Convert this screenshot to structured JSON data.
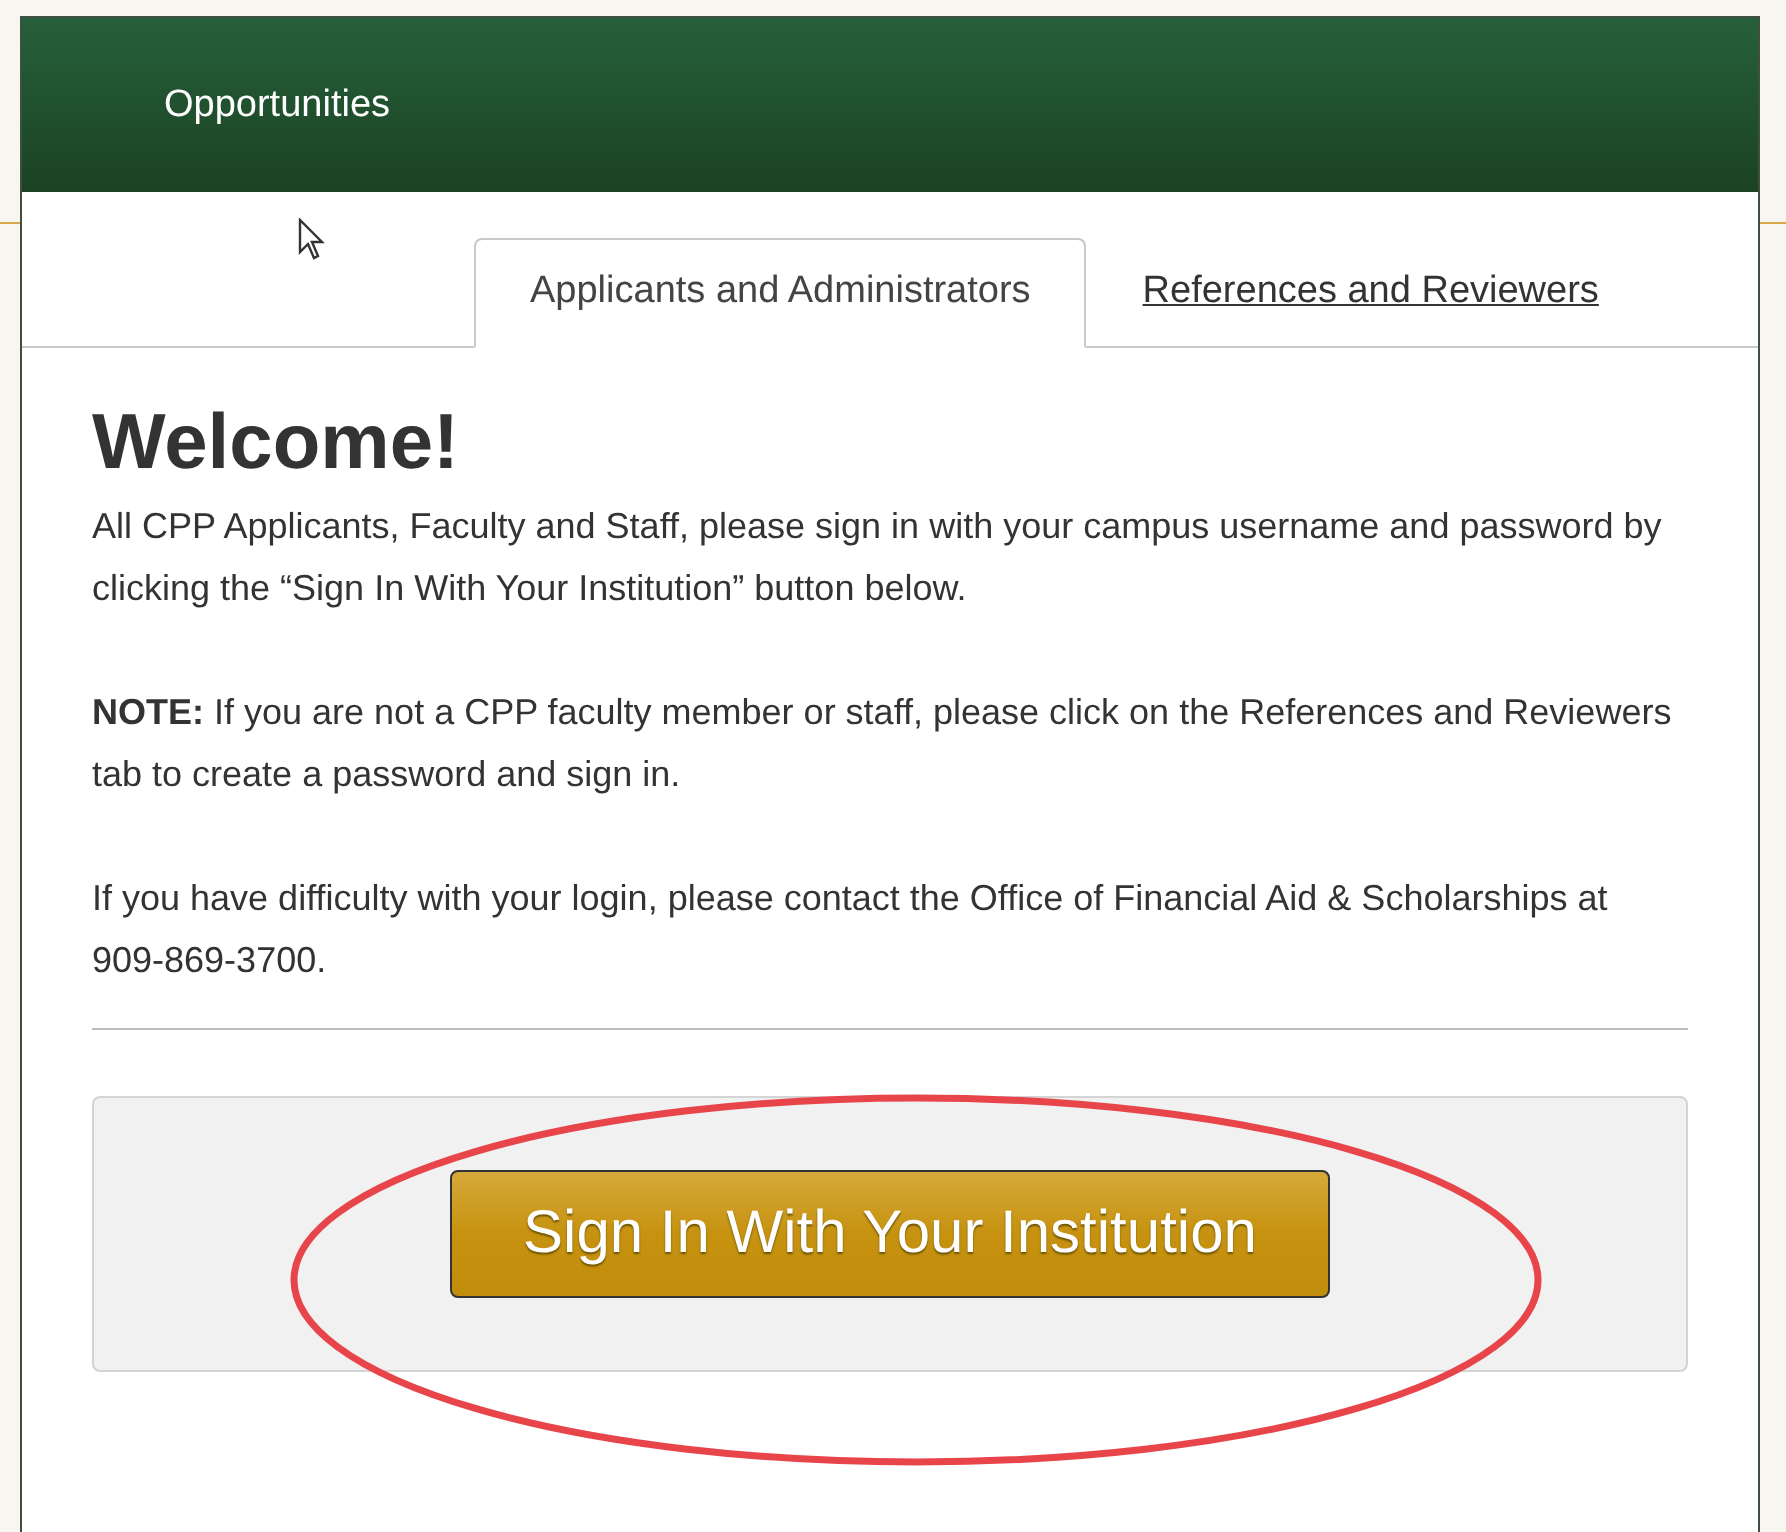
{
  "header": {
    "title": "Opportunities"
  },
  "tabs": [
    {
      "label": "Applicants and Administrators",
      "selected": true
    },
    {
      "label": "References and Reviewers",
      "selected": false
    }
  ],
  "content": {
    "heading": "Welcome!",
    "paragraphs": [
      "All CPP Applicants, Faculty and Staff, please sign in with your campus username and password by clicking the “Sign In With Your Institution” button below.",
      "**NOTE:** If you are not a CPP faculty member or staff, please click on the References and Reviewers tab to create a password and sign in.",
      "If you have difficulty with your login, please contact the Office of Financial Aid & Scholarships at 909-869-3700."
    ],
    "sign_in_button": "Sign In With Your Institution"
  }
}
